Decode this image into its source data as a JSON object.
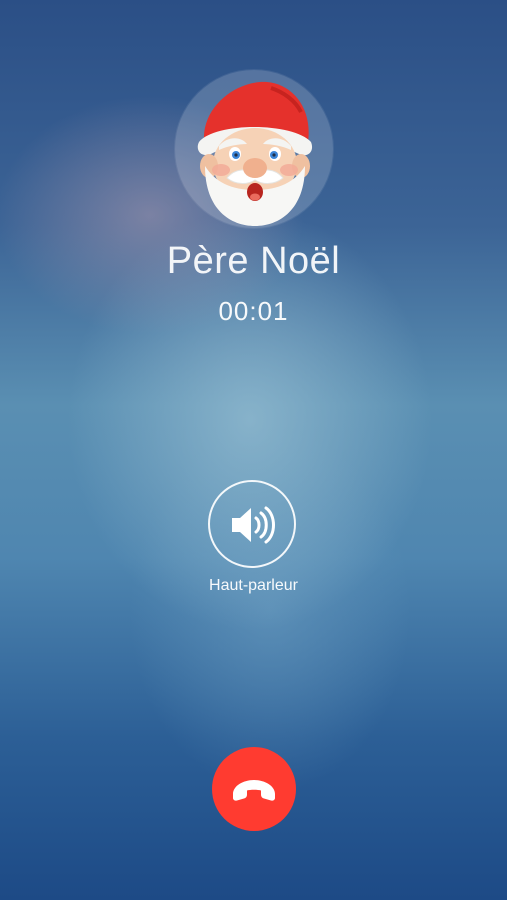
{
  "call": {
    "contact_name": "Père Noël",
    "timer": "00:01"
  },
  "controls": {
    "speaker": {
      "label": "Haut-parleur",
      "icon": "speaker-icon"
    },
    "end_call": {
      "icon": "phone-hangup-icon",
      "color": "#ff3b30"
    }
  },
  "avatar": {
    "icon": "santa-claus-avatar"
  }
}
